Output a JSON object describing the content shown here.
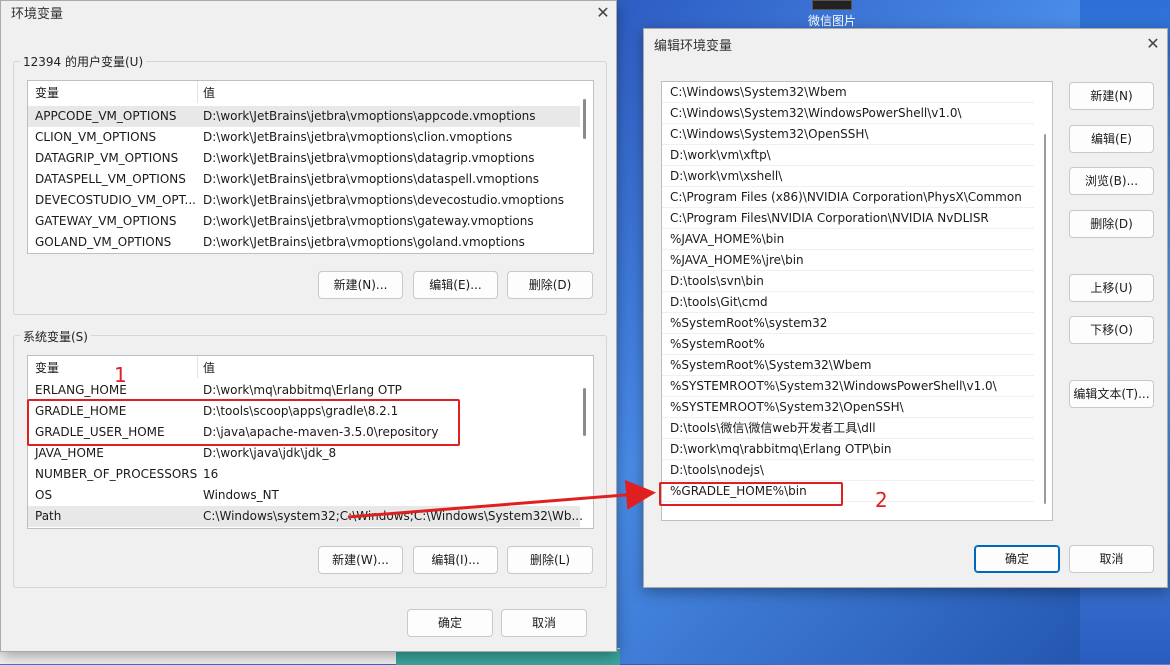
{
  "desktop": {
    "icon_label": "微信图片"
  },
  "env_window": {
    "title": "环境变量",
    "user_group": {
      "label": "12394 的用户变量(U)",
      "headers": [
        "变量",
        "值"
      ],
      "rows": [
        [
          "APPCODE_VM_OPTIONS",
          "D:\\work\\JetBrains\\jetbra\\vmoptions\\appcode.vmoptions"
        ],
        [
          "CLION_VM_OPTIONS",
          "D:\\work\\JetBrains\\jetbra\\vmoptions\\clion.vmoptions"
        ],
        [
          "DATAGRIP_VM_OPTIONS",
          "D:\\work\\JetBrains\\jetbra\\vmoptions\\datagrip.vmoptions"
        ],
        [
          "DATASPELL_VM_OPTIONS",
          "D:\\work\\JetBrains\\jetbra\\vmoptions\\dataspell.vmoptions"
        ],
        [
          "DEVECOSTUDIO_VM_OPT...",
          "D:\\work\\JetBrains\\jetbra\\vmoptions\\devecostudio.vmoptions"
        ],
        [
          "GATEWAY_VM_OPTIONS",
          "D:\\work\\JetBrains\\jetbra\\vmoptions\\gateway.vmoptions"
        ],
        [
          "GOLAND_VM_OPTIONS",
          "D:\\work\\JetBrains\\jetbra\\vmoptions\\goland.vmoptions"
        ]
      ],
      "btn_new": "新建(N)...",
      "btn_edit": "编辑(E)...",
      "btn_delete": "删除(D)"
    },
    "sys_group": {
      "label": "系统变量(S)",
      "headers": [
        "变量",
        "值"
      ],
      "rows": [
        [
          "ERLANG_HOME",
          "D:\\work\\mq\\rabbitmq\\Erlang OTP"
        ],
        [
          "GRADLE_HOME",
          "D:\\tools\\scoop\\apps\\gradle\\8.2.1"
        ],
        [
          "GRADLE_USER_HOME",
          "D:\\java\\apache-maven-3.5.0\\repository"
        ],
        [
          "JAVA_HOME",
          "D:\\work\\java\\jdk\\jdk_8"
        ],
        [
          "NUMBER_OF_PROCESSORS",
          "16"
        ],
        [
          "OS",
          "Windows_NT"
        ],
        [
          "Path",
          "C:\\Windows\\system32;C:\\Windows;C:\\Windows\\System32\\Wb..."
        ]
      ],
      "btn_new": "新建(W)...",
      "btn_edit": "编辑(I)...",
      "btn_delete": "删除(L)"
    },
    "btn_ok": "确定",
    "btn_cancel": "取消"
  },
  "edit_window": {
    "title": "编辑环境变量",
    "paths": [
      "C:\\Windows\\System32\\Wbem",
      "C:\\Windows\\System32\\WindowsPowerShell\\v1.0\\",
      "C:\\Windows\\System32\\OpenSSH\\",
      "D:\\work\\vm\\xftp\\",
      "D:\\work\\vm\\xshell\\",
      "C:\\Program Files (x86)\\NVIDIA Corporation\\PhysX\\Common",
      "C:\\Program Files\\NVIDIA Corporation\\NVIDIA NvDLISR",
      "%JAVA_HOME%\\bin",
      "%JAVA_HOME%\\jre\\bin",
      "D:\\tools\\svn\\bin",
      "D:\\tools\\Git\\cmd",
      "%SystemRoot%\\system32",
      "%SystemRoot%",
      "%SystemRoot%\\System32\\Wbem",
      "%SYSTEMROOT%\\System32\\WindowsPowerShell\\v1.0\\",
      "%SYSTEMROOT%\\System32\\OpenSSH\\",
      "D:\\tools\\微信\\微信web开发者工具\\dll",
      "D:\\work\\mq\\rabbitmq\\Erlang OTP\\bin",
      "D:\\tools\\nodejs\\",
      "%GRADLE_HOME%\\bin"
    ],
    "btn_new": "新建(N)",
    "btn_edit": "编辑(E)",
    "btn_browse": "浏览(B)...",
    "btn_delete": "删除(D)",
    "btn_up": "上移(U)",
    "btn_down": "下移(O)",
    "btn_edit_text": "编辑文本(T)...",
    "btn_ok": "确定",
    "btn_cancel": "取消"
  },
  "annotations": {
    "label_1": "1",
    "label_2": "2",
    "color": "#e02020"
  }
}
